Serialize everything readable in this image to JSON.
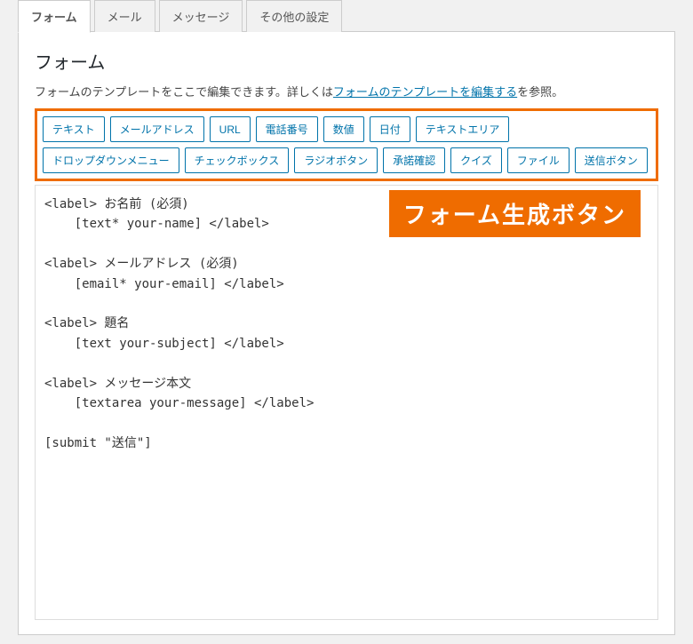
{
  "tabs": [
    {
      "label": "フォーム",
      "active": true
    },
    {
      "label": "メール",
      "active": false
    },
    {
      "label": "メッセージ",
      "active": false
    },
    {
      "label": "その他の設定",
      "active": false
    }
  ],
  "panel": {
    "title": "フォーム",
    "desc_prefix": "フォームのテンプレートをここで編集できます。詳しくは",
    "desc_link": "フォームのテンプレートを編集する",
    "desc_suffix": "を参照。"
  },
  "tag_buttons": [
    "テキスト",
    "メールアドレス",
    "URL",
    "電話番号",
    "数値",
    "日付",
    "テキストエリア",
    "ドロップダウンメニュー",
    "チェックボックス",
    "ラジオボタン",
    "承諾確認",
    "クイズ",
    "ファイル",
    "送信ボタン"
  ],
  "annotation": "フォーム生成ボタン",
  "textarea_value": "<label> お名前 (必須)\n    [text* your-name] </label>\n\n<label> メールアドレス (必須)\n    [email* your-email] </label>\n\n<label> 題名\n    [text your-subject] </label>\n\n<label> メッセージ本文\n    [textarea your-message] </label>\n\n[submit \"送信\"]"
}
